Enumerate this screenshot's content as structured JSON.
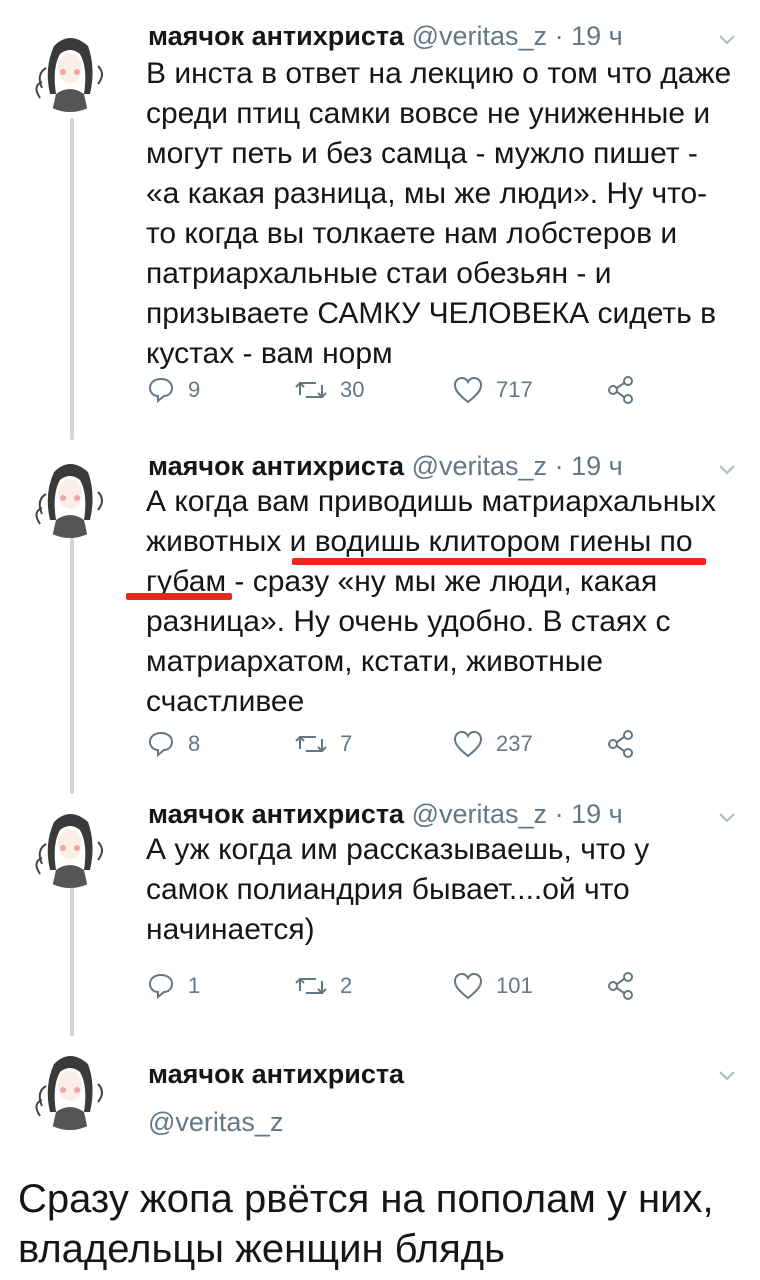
{
  "tweets": [
    {
      "author_name": "маячок антихриста",
      "handle": "@veritas_z",
      "separator": "·",
      "time": "19 ч",
      "text": "В инста в ответ на лекцию о том что даже среди птиц самки вовсе не униженные и могут петь и без самца - мужло пишет - «а какая разница, мы же люди». Ну что-то когда вы толкаете нам лобстеров и патриархальные стаи обезьян - и призываете САМКУ ЧЕЛОВЕКА сидеть в кустах - вам норм",
      "replies": "9",
      "retweets": "30",
      "likes": "717"
    },
    {
      "author_name": "маячок антихриста",
      "handle": "@veritas_z",
      "separator": "·",
      "time": "19 ч",
      "text": "А когда вам приводишь матриархальных животных и водишь клитором гиены по губам - сразу «ну мы же люди, какая разница». Ну очень удобно. В стаях с матриархатом, кстати, животные счастливее",
      "replies": "8",
      "retweets": "7",
      "likes": "237"
    },
    {
      "author_name": "маячок антихриста",
      "handle": "@veritas_z",
      "separator": "·",
      "time": "19 ч",
      "text": "А уж когда им рассказываешь, что у самок полиандрия бывает....ой что начинается)",
      "replies": "1",
      "retweets": "2",
      "likes": "101"
    }
  ],
  "final_tweet": {
    "author_name": "маячок антихриста",
    "handle": "@veritas_z"
  },
  "caption": "Сразу жопа рвётся на пополам у них, владельцы женщин блядь",
  "colors": {
    "text": "#14171a",
    "secondary": "#657786",
    "thread_line": "#cfd6dc",
    "highlight_underline": "#e8281c"
  },
  "icons": [
    "reply-icon",
    "retweet-icon",
    "like-icon",
    "share-icon",
    "chevron-down-icon",
    "avatar"
  ]
}
